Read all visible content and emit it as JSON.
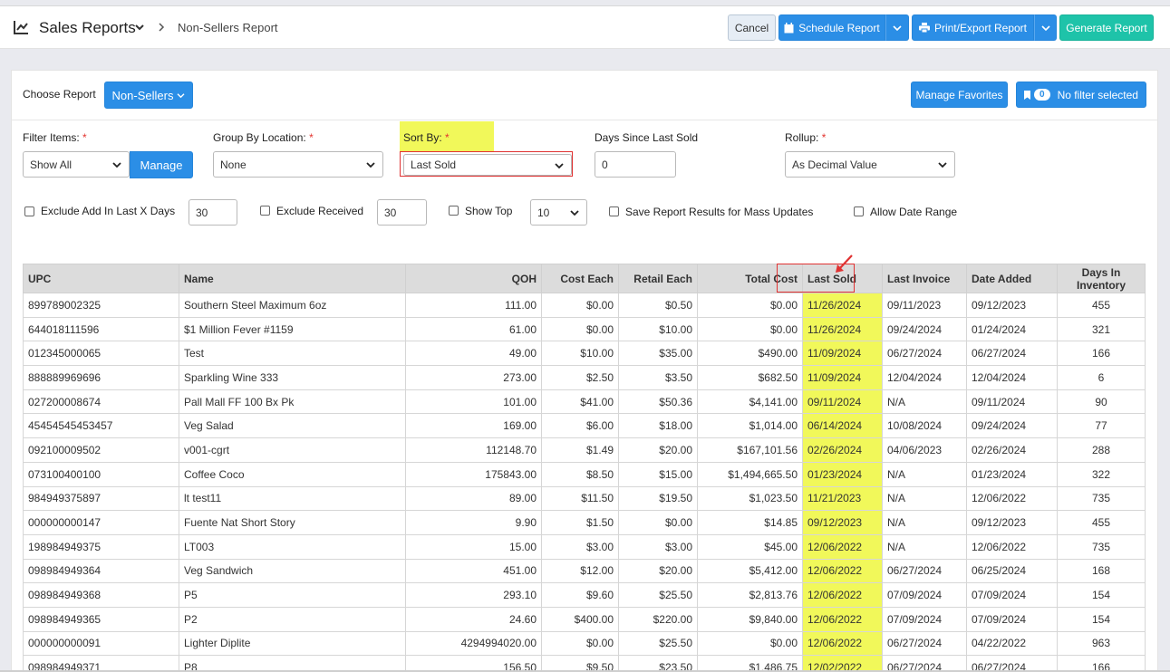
{
  "header": {
    "title": "Sales Reports",
    "breadcrumb": "Non-Sellers Report",
    "cancel_label": "Cancel",
    "schedule_label": "Schedule Report",
    "print_label": "Print/Export Report",
    "generate_label": "Generate Report"
  },
  "report": {
    "choose_label": "Choose Report",
    "selected": "Non-Sellers",
    "manage_favorites": "Manage Favorites",
    "filter_count": "0",
    "filter_label": "No filter selected"
  },
  "filters": {
    "filter_items_label": "Filter Items:",
    "filter_items_value": "Show All",
    "manage_label": "Manage",
    "group_label": "Group By Location:",
    "group_value": "None",
    "sort_label": "Sort By:",
    "sort_value": "Last Sold",
    "days_label": "Days Since Last Sold",
    "days_value": "0",
    "rollup_label": "Rollup:",
    "rollup_value": "As Decimal Value",
    "required_mark": "*"
  },
  "options": {
    "exclude_add_label": "Exclude Add In Last X Days",
    "exclude_add_value": "30",
    "exclude_received_label": "Exclude Received",
    "exclude_received_value": "30",
    "show_top_label": "Show Top",
    "show_top_value": "10",
    "save_results_label": "Save Report Results for Mass Updates",
    "allow_date_label": "Allow Date Range"
  },
  "table": {
    "columns": [
      "UPC",
      "Name",
      "QOH",
      "Cost Each",
      "Retail Each",
      "Total Cost",
      "Last Sold",
      "Last Invoice",
      "Date Added",
      "Days In Inventory"
    ],
    "rows": [
      [
        "899789002325",
        "Southern Steel Maximum 6oz",
        "111.00",
        "$0.00",
        "$0.50",
        "$0.00",
        "11/26/2024",
        "09/11/2023",
        "09/12/2023",
        "455"
      ],
      [
        "644018111596",
        "$1 Million Fever #1159",
        "61.00",
        "$0.00",
        "$10.00",
        "$0.00",
        "11/26/2024",
        "09/24/2024",
        "01/24/2024",
        "321"
      ],
      [
        "012345000065",
        "Test",
        "49.00",
        "$10.00",
        "$35.00",
        "$490.00",
        "11/09/2024",
        "06/27/2024",
        "06/27/2024",
        "166"
      ],
      [
        "888889969696",
        "Sparkling Wine 333",
        "273.00",
        "$2.50",
        "$3.50",
        "$682.50",
        "11/09/2024",
        "12/04/2024",
        "12/04/2024",
        "6"
      ],
      [
        "027200008674",
        "Pall Mall FF 100 Bx Pk",
        "101.00",
        "$41.00",
        "$50.36",
        "$4,141.00",
        "09/11/2024",
        "N/A",
        "09/11/2024",
        "90"
      ],
      [
        "45454545453457",
        "Veg Salad",
        "169.00",
        "$6.00",
        "$18.00",
        "$1,014.00",
        "06/14/2024",
        "10/08/2024",
        "09/24/2024",
        "77"
      ],
      [
        "092100009502",
        "v001-cgrt",
        "112148.70",
        "$1.49",
        "$20.00",
        "$167,101.56",
        "02/26/2024",
        "04/06/2023",
        "02/26/2024",
        "288"
      ],
      [
        "073100400100",
        "Coffee Coco",
        "175843.00",
        "$8.50",
        "$15.00",
        "$1,494,665.50",
        "01/23/2024",
        "N/A",
        "01/23/2024",
        "322"
      ],
      [
        "984949375897",
        "lt test11",
        "89.00",
        "$11.50",
        "$19.50",
        "$1,023.50",
        "11/21/2023",
        "N/A",
        "12/06/2022",
        "735"
      ],
      [
        "000000000147",
        "Fuente Nat Short Story",
        "9.90",
        "$1.50",
        "$0.00",
        "$14.85",
        "09/12/2023",
        "N/A",
        "09/12/2023",
        "455"
      ],
      [
        "198984949375",
        "LT003",
        "15.00",
        "$3.00",
        "$3.00",
        "$45.00",
        "12/06/2022",
        "N/A",
        "12/06/2022",
        "735"
      ],
      [
        "098984949364",
        "Veg Sandwich",
        "451.00",
        "$12.00",
        "$20.00",
        "$5,412.00",
        "12/06/2022",
        "06/27/2024",
        "06/25/2024",
        "168"
      ],
      [
        "098984949368",
        "P5",
        "293.10",
        "$9.60",
        "$25.50",
        "$2,813.76",
        "12/06/2022",
        "07/09/2024",
        "07/09/2024",
        "154"
      ],
      [
        "098984949365",
        "P2",
        "24.60",
        "$400.00",
        "$220.00",
        "$9,840.00",
        "12/06/2022",
        "07/09/2024",
        "07/09/2024",
        "154"
      ],
      [
        "000000000091",
        "Lighter Diplite",
        "4294994020.00",
        "$0.00",
        "$25.50",
        "$0.00",
        "12/06/2022",
        "06/27/2024",
        "04/22/2022",
        "963"
      ],
      [
        "098984949371",
        "P8",
        "156.50",
        "$9.50",
        "$23.50",
        "$1,486.75",
        "12/02/2022",
        "06/27/2024",
        "06/27/2024",
        "166"
      ]
    ]
  },
  "colors": {
    "primary": "#2b8ee6",
    "generate": "#1ec3a9",
    "highlight": "#f1f85a",
    "annotation": "#e03232"
  }
}
